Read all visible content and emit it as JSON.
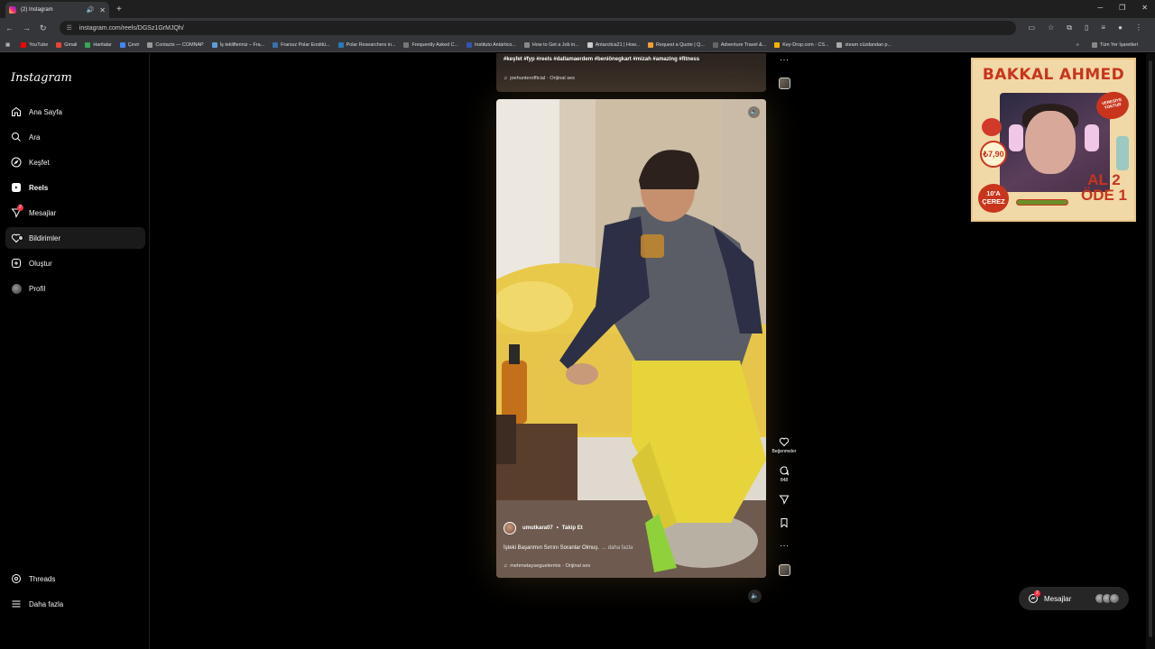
{
  "browser": {
    "tab_title": "(2) Instagram",
    "new_tab": "+",
    "url": "instagram.com/reels/DGSz1GrMJQh/",
    "bookmarks": [
      {
        "label": "YouTube",
        "color": "#ff0000"
      },
      {
        "label": "Gmail",
        "color": "#ea4335"
      },
      {
        "label": "Haritalar",
        "color": "#34a853"
      },
      {
        "label": "Çevir",
        "color": "#4285f4"
      },
      {
        "label": "Contacts — COMNAP",
        "color": "#999999"
      },
      {
        "label": "İş teklifleriniz – Fra...",
        "color": "#5f9ad8"
      },
      {
        "label": "Fransız Polar Enstitü...",
        "color": "#3c6ea8"
      },
      {
        "label": "Polar Researchers in...",
        "color": "#2a7ab5"
      },
      {
        "label": "Frequently Asked C...",
        "color": "#777777"
      },
      {
        "label": "Instituto Antártico...",
        "color": "#3355aa"
      },
      {
        "label": "How to Get a Job in...",
        "color": "#888888"
      },
      {
        "label": "Antarctica21 | How...",
        "color": "#cccccc"
      },
      {
        "label": "Request a Quote | Q...",
        "color": "#f0a030"
      },
      {
        "label": "Adventure Travel &...",
        "color": "#666666"
      },
      {
        "label": "Key-Drop.com - CS...",
        "color": "#f5b400"
      },
      {
        "label": "steam cüzdandan p...",
        "color": "#aaaaaa"
      }
    ],
    "bookmarks_overflow": "»",
    "all_bookmarks": "Tüm Yer İşaretleri"
  },
  "sidebar": {
    "logo": "Instagram",
    "items": [
      {
        "label": "Ana Sayfa",
        "icon": "home-icon"
      },
      {
        "label": "Ara",
        "icon": "search-icon"
      },
      {
        "label": "Keşfet",
        "icon": "compass-icon"
      },
      {
        "label": "Reels",
        "icon": "reels-icon"
      },
      {
        "label": "Mesajlar",
        "icon": "messenger-icon",
        "badge": "2"
      },
      {
        "label": "Bildirimler",
        "icon": "heart-icon"
      },
      {
        "label": "Oluştur",
        "icon": "plus-square-icon"
      },
      {
        "label": "Profil",
        "icon": "avatar"
      }
    ],
    "bottom": [
      {
        "label": "Threads",
        "icon": "threads-icon"
      },
      {
        "label": "Daha fazla",
        "icon": "menu-icon"
      }
    ]
  },
  "prev_reel": {
    "tags": "#keşfet #fyp #reels #dallamaerdem #beniönegkart #mizah #amazing #fitness",
    "audio": "joehunterofficial · Orijinal ses"
  },
  "reel": {
    "username": "umutkara07",
    "separator": "•",
    "follow": "Takip Et",
    "caption": "İşteki Başarımın Sırrını Soranlar Olmuş.",
    "more": "... daha fazla",
    "audio": "mehmetayseguelermis · Orijinal ses",
    "likes_label": "Beğenmeler",
    "comments": "848"
  },
  "overlay": {
    "brand": "BAKKAL AHMED",
    "price": "₺7,90",
    "veresiye": "VERESİYE YOKTUR",
    "cerez": "10'A ÇEREZ",
    "promo_line1": "AL 2",
    "promo_line2": "ÖDE 1"
  },
  "messages_pill": {
    "label": "Mesajlar",
    "badge": "2"
  },
  "colors": {
    "accent_red": "#ff3040",
    "background": "#000000"
  }
}
